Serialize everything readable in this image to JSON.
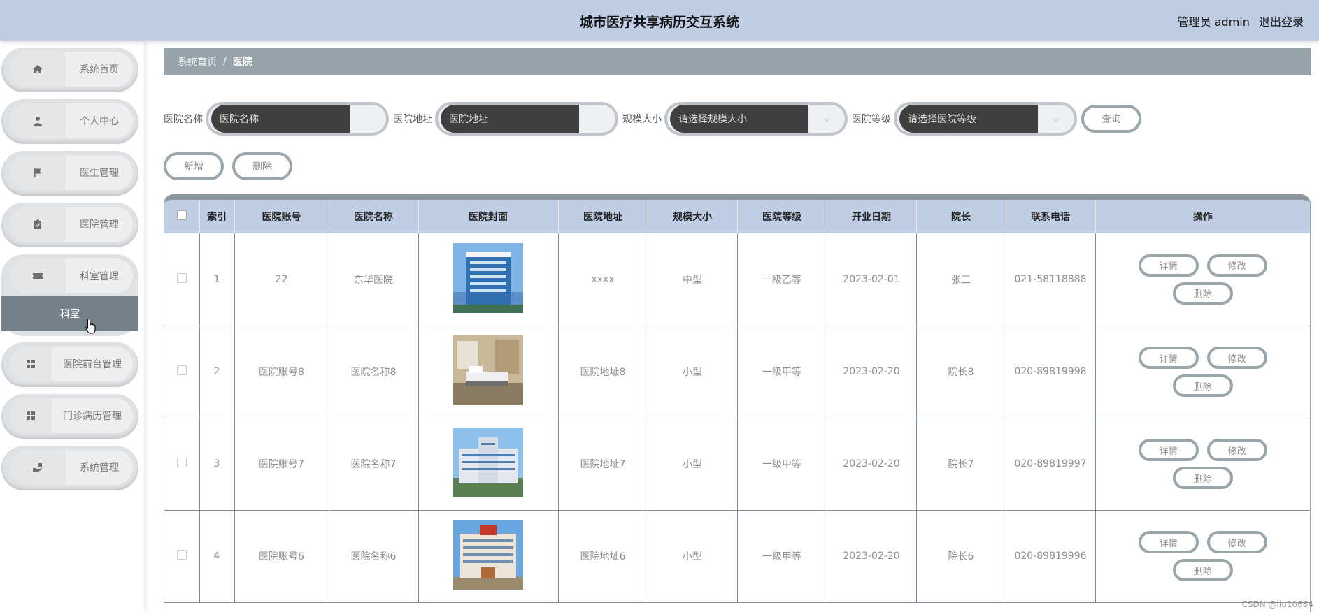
{
  "header": {
    "title": "城市医疗共享病历交互系统",
    "role": "管理员 admin",
    "logout": "退出登录"
  },
  "sidebar": {
    "items": [
      {
        "label": "系统首页",
        "icon": "home-icon"
      },
      {
        "label": "个人中心",
        "icon": "person-icon"
      },
      {
        "label": "医生管理",
        "icon": "flag-icon"
      },
      {
        "label": "医院管理",
        "icon": "clipboard-icon"
      },
      {
        "label": "科室管理",
        "icon": "ticket-icon"
      },
      {
        "label": "医院前台管理",
        "icon": "grid-icon"
      },
      {
        "label": "门诊病历管理",
        "icon": "grid-icon"
      },
      {
        "label": "系统管理",
        "icon": "settings-hand-icon"
      }
    ],
    "sub_item": "科室"
  },
  "breadcrumb": {
    "home": "系统首页",
    "sep": "/",
    "current": "医院"
  },
  "filters": {
    "name_label": "医院名称",
    "name_placeholder": "医院名称",
    "address_label": "医院地址",
    "address_placeholder": "医院地址",
    "size_label": "规模大小",
    "size_placeholder": "请选择规模大小",
    "level_label": "医院等级",
    "level_placeholder": "请选择医院等级",
    "search_button": "查询"
  },
  "actions": {
    "add": "新增",
    "delete": "删除"
  },
  "table": {
    "columns": [
      "",
      "索引",
      "医院账号",
      "医院名称",
      "医院封面",
      "医院地址",
      "规模大小",
      "医院等级",
      "开业日期",
      "院长",
      "联系电话",
      "操作"
    ],
    "op_labels": {
      "detail": "详情",
      "edit": "修改",
      "delete": "删除"
    },
    "rows": [
      {
        "index": "1",
        "account": "22",
        "name": "东华医院",
        "address": "xxxx",
        "size": "中型",
        "level": "一级乙等",
        "date": "2023-02-01",
        "dean": "张三",
        "phone": "021-58118888"
      },
      {
        "index": "2",
        "account": "医院账号8",
        "name": "医院名称8",
        "address": "医院地址8",
        "size": "小型",
        "level": "一级甲等",
        "date": "2023-02-20",
        "dean": "院长8",
        "phone": "020-89819998"
      },
      {
        "index": "3",
        "account": "医院账号7",
        "name": "医院名称7",
        "address": "医院地址7",
        "size": "小型",
        "level": "一级甲等",
        "date": "2023-02-20",
        "dean": "院长7",
        "phone": "020-89819997"
      },
      {
        "index": "4",
        "account": "医院账号6",
        "name": "医院名称6",
        "address": "医院地址6",
        "size": "小型",
        "level": "一级甲等",
        "date": "2023-02-20",
        "dean": "院长6",
        "phone": "020-89819996"
      }
    ]
  },
  "watermark": "CSDN @liu10664",
  "colors": {
    "header": "#bfcee5",
    "breadcrumb": "#97a3ab",
    "active_sub": "#748189",
    "button_border": "#9aa5ac"
  }
}
